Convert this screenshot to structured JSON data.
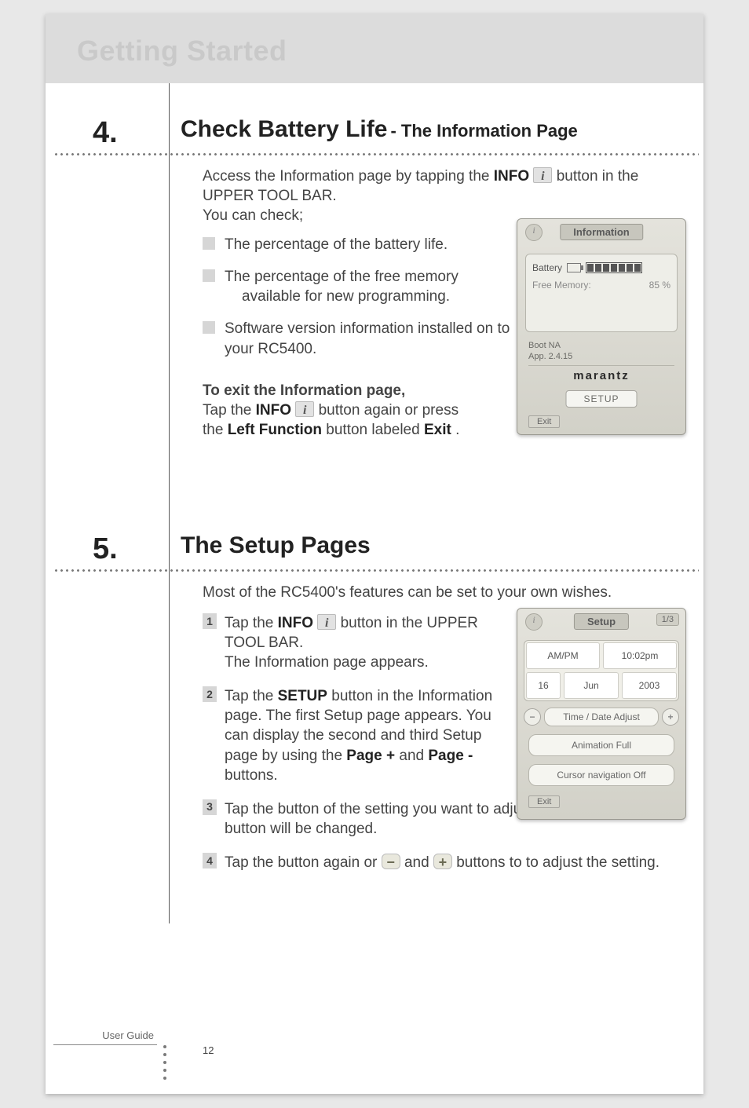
{
  "chapter_title": "Getting Started",
  "section4": {
    "number": "4.",
    "heading_main": "Check Battery Life",
    "heading_sub": "- The Information Page",
    "intro_l1a": "Access the Information page by tapping the ",
    "intro_l1b": "INFO",
    "intro_l1c": " button in the UPPER TOOL BAR.",
    "intro_l2": "You can check;",
    "bullets": [
      "The percentage of the battery life.",
      "The percentage of the free memory available for new programming.",
      "Software version information installed on to your RC5400."
    ],
    "bullets_line2": {
      "1": "available for new programming."
    },
    "exit_title": "To exit the Information page,",
    "exit_l1a": "Tap the ",
    "exit_l1b": "INFO",
    "exit_l1c": " button again or press",
    "exit_l2a": "the ",
    "exit_l2b": "Left Function",
    "exit_l2c": " button labeled ",
    "exit_l2d": "Exit",
    "exit_l2e": " ."
  },
  "info_screenshot": {
    "title": "Information",
    "battery_label": "Battery",
    "freemem_label": "Free Memory:",
    "freemem_value": "85 %",
    "boot": "Boot NA",
    "app": "App. 2.4.15",
    "brand": "marantz",
    "setup_btn": "SETUP",
    "exit": "Exit"
  },
  "section5": {
    "number": "5.",
    "heading": "The Setup Pages",
    "intro": "Most of the RC5400's features can be set to your own wishes.",
    "steps": {
      "1": {
        "a": "Tap the ",
        "b": "INFO",
        "c": " button in the UPPER TOOL BAR.",
        "d": "The Information page appears."
      },
      "2": {
        "a": "Tap the ",
        "b": "SETUP",
        "c": " button in the Information page. The first Setup page appears. You can display the second and third Setup page by using the ",
        "d": "Page +",
        "e": " and ",
        "f": "Page -",
        "g": " buttons."
      },
      "3": "Tap the button of the setting you want to adjust. The color of the button will be changed.",
      "4": {
        "a": "Tap the button again or ",
        "b": " and ",
        "c": " buttons to to adjust the setting."
      }
    }
  },
  "setup_screenshot": {
    "title": "Setup",
    "page": "1/3",
    "ampm": "AM/PM",
    "time": "10:02pm",
    "day": "16",
    "month": "Jun",
    "year": "2003",
    "timedate": "Time / Date Adjust",
    "animation": "Animation Full",
    "cursor": "Cursor navigation Off",
    "exit": "Exit"
  },
  "footer": {
    "label": "User Guide",
    "page_number": "12"
  }
}
